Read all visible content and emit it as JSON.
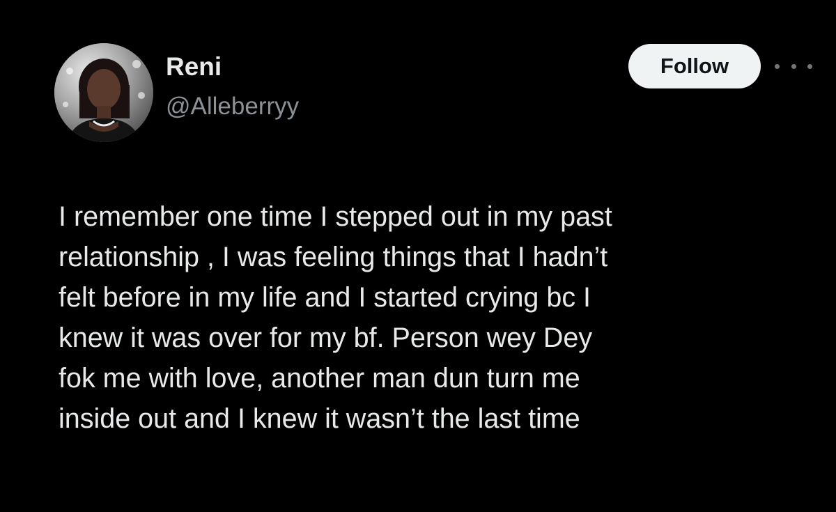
{
  "author": {
    "display_name": "Reni",
    "handle": "@Alleberryy",
    "avatar_icon": "profile-photo"
  },
  "actions": {
    "follow_label": "Follow",
    "more_icon": "more-horizontal-icon"
  },
  "tweet": {
    "lines": [
      "I remember one time I stepped out in my past",
      "relationship , I was feeling things that I hadn’t",
      "felt before in my life and I started crying bc I",
      "knew it was over for my bf. Person wey Dey",
      "fok me with love, another man dun turn me",
      "inside out and I knew it wasn’t the last time"
    ]
  },
  "colors": {
    "background": "#000000",
    "text_primary": "#e7e9ea",
    "text_secondary": "#8b9197",
    "follow_bg": "#eff3f4",
    "follow_text": "#0f1419"
  }
}
